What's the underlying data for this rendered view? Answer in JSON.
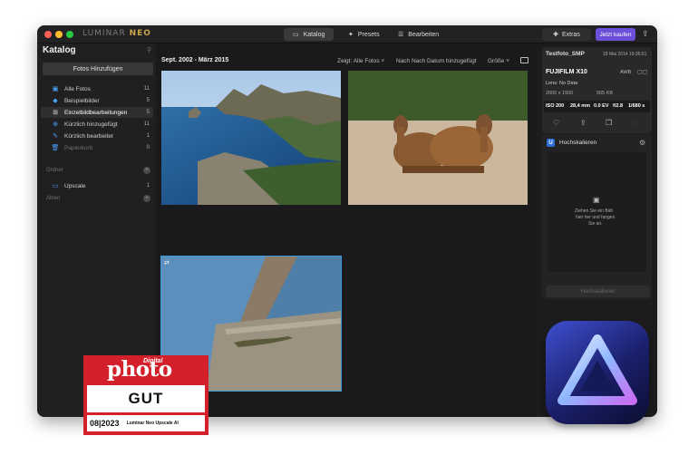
{
  "window": {
    "brand_prefix": "LUMINAR",
    "brand_suffix": "NEO",
    "tabs": [
      {
        "label": "Katalog",
        "icon": "folder-icon",
        "active": true
      },
      {
        "label": "Presets",
        "icon": "presets-icon",
        "active": false
      },
      {
        "label": "Bearbeiten",
        "icon": "sliders-icon",
        "active": false
      }
    ],
    "extras_label": "Extras",
    "buy_label": "Jetzt kaufen"
  },
  "sidebar": {
    "title": "Katalog",
    "add_button": "Fotos Hinzufügen",
    "items": [
      {
        "label": "Alle Fotos",
        "count": "11",
        "icon": "photos-icon"
      },
      {
        "label": "Beispielbilder",
        "count": "5",
        "icon": "graduation-cap-icon"
      },
      {
        "label": "Einzelbildbearbeitungen",
        "count": "5",
        "icon": "grid-icon",
        "active": true
      },
      {
        "label": "Kürzlich hinzugefügt",
        "count": "11",
        "icon": "recent-added-icon"
      },
      {
        "label": "Kürzlich bearbeitet",
        "count": "1",
        "icon": "recent-edited-icon"
      },
      {
        "label": "Papierkorb",
        "count": "0",
        "icon": "trash-icon"
      }
    ],
    "folders_section": "Ordner",
    "folder_item": {
      "label": "Upscale",
      "count": "1"
    },
    "albums_section": "Alben"
  },
  "main": {
    "date_range": "Sept. 2002 - März 2015",
    "filter_show": "Zeigt: Alle Fotos",
    "filter_sort": "Nach Nach Datum hinzugefügt",
    "filter_size": "Größe"
  },
  "info": {
    "filename": "Testfoto_SMP",
    "date": "18 Mai 2014 16:35:51",
    "camera": "FUJIFILM X10",
    "wb": "AWB",
    "lens": "Lens: No Data",
    "dimensions": "2000 x 1500",
    "filesize": "565 KB",
    "iso": "ISO 200",
    "focal": "28,4 mm",
    "ev": "0.0 EV",
    "aperture": "f/2.8",
    "shutter": "1/680 s"
  },
  "upscale": {
    "title": "Hochskalieren",
    "drop_hint_1": "Ziehen Sie ein Bild",
    "drop_hint_2": "hier her und fangen",
    "drop_hint_3": "Sie an.",
    "button": "Hochskalieren"
  },
  "badge": {
    "brand_small": "Digital",
    "brand": "photo",
    "rating": "GUT",
    "issue": "08|2023",
    "product": "Luminar Neo Upscale AI"
  },
  "colors": {
    "accent_purple": "#6b4fd8",
    "selection_blue": "#3a9bd8",
    "badge_red": "#d4202a"
  }
}
